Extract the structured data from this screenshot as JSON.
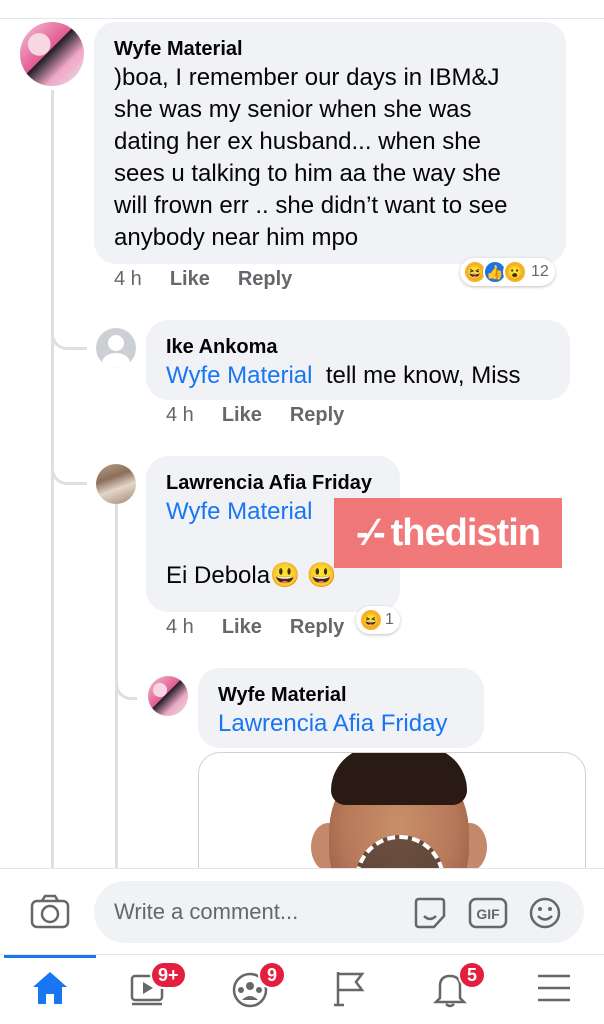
{
  "comments": {
    "main": {
      "author": "Wyfe Material",
      "lines": [
        ")boa, I remember our days in IBM&J",
        "she was my senior when she was",
        "dating her  ex husband... when she",
        "sees u talking to him aa the way she",
        "will frown err .. she didn’t want to see",
        "anybody near him mpo"
      ],
      "time": "4 h",
      "like_label": "Like",
      "reply_label": "Reply",
      "reaction_count": "12",
      "reactions": [
        "haha-icon",
        "like-icon",
        "wow-icon"
      ]
    },
    "reply1": {
      "author": "Ike Ankoma",
      "mention": "Wyfe Material",
      "text": "tell me know, Miss",
      "time": "4 h",
      "like_label": "Like",
      "reply_label": "Reply"
    },
    "reply2": {
      "author": "Lawrencia Afia Friday",
      "mention": "Wyfe Material",
      "text": "Ei Debola",
      "emojis": "😃 😃",
      "time": "4 h",
      "like_label": "Like",
      "reply_label": "Reply",
      "reaction_count": "1",
      "reactions": [
        "haha-icon"
      ]
    },
    "reply3": {
      "author": "Wyfe Material",
      "mention": "Lawrencia Afia Friday"
    }
  },
  "watermark": {
    "text": "thedistin",
    "mark": "-⁄-"
  },
  "composer": {
    "placeholder": "Write a comment..."
  },
  "nav": {
    "video_badge": "9+",
    "groups_badge": "9",
    "notifications_badge": "5"
  },
  "colors": {
    "accent": "#1876f2",
    "badge": "#e41e3f",
    "bubble": "#f0f2f5",
    "watermark": "#f06262"
  }
}
